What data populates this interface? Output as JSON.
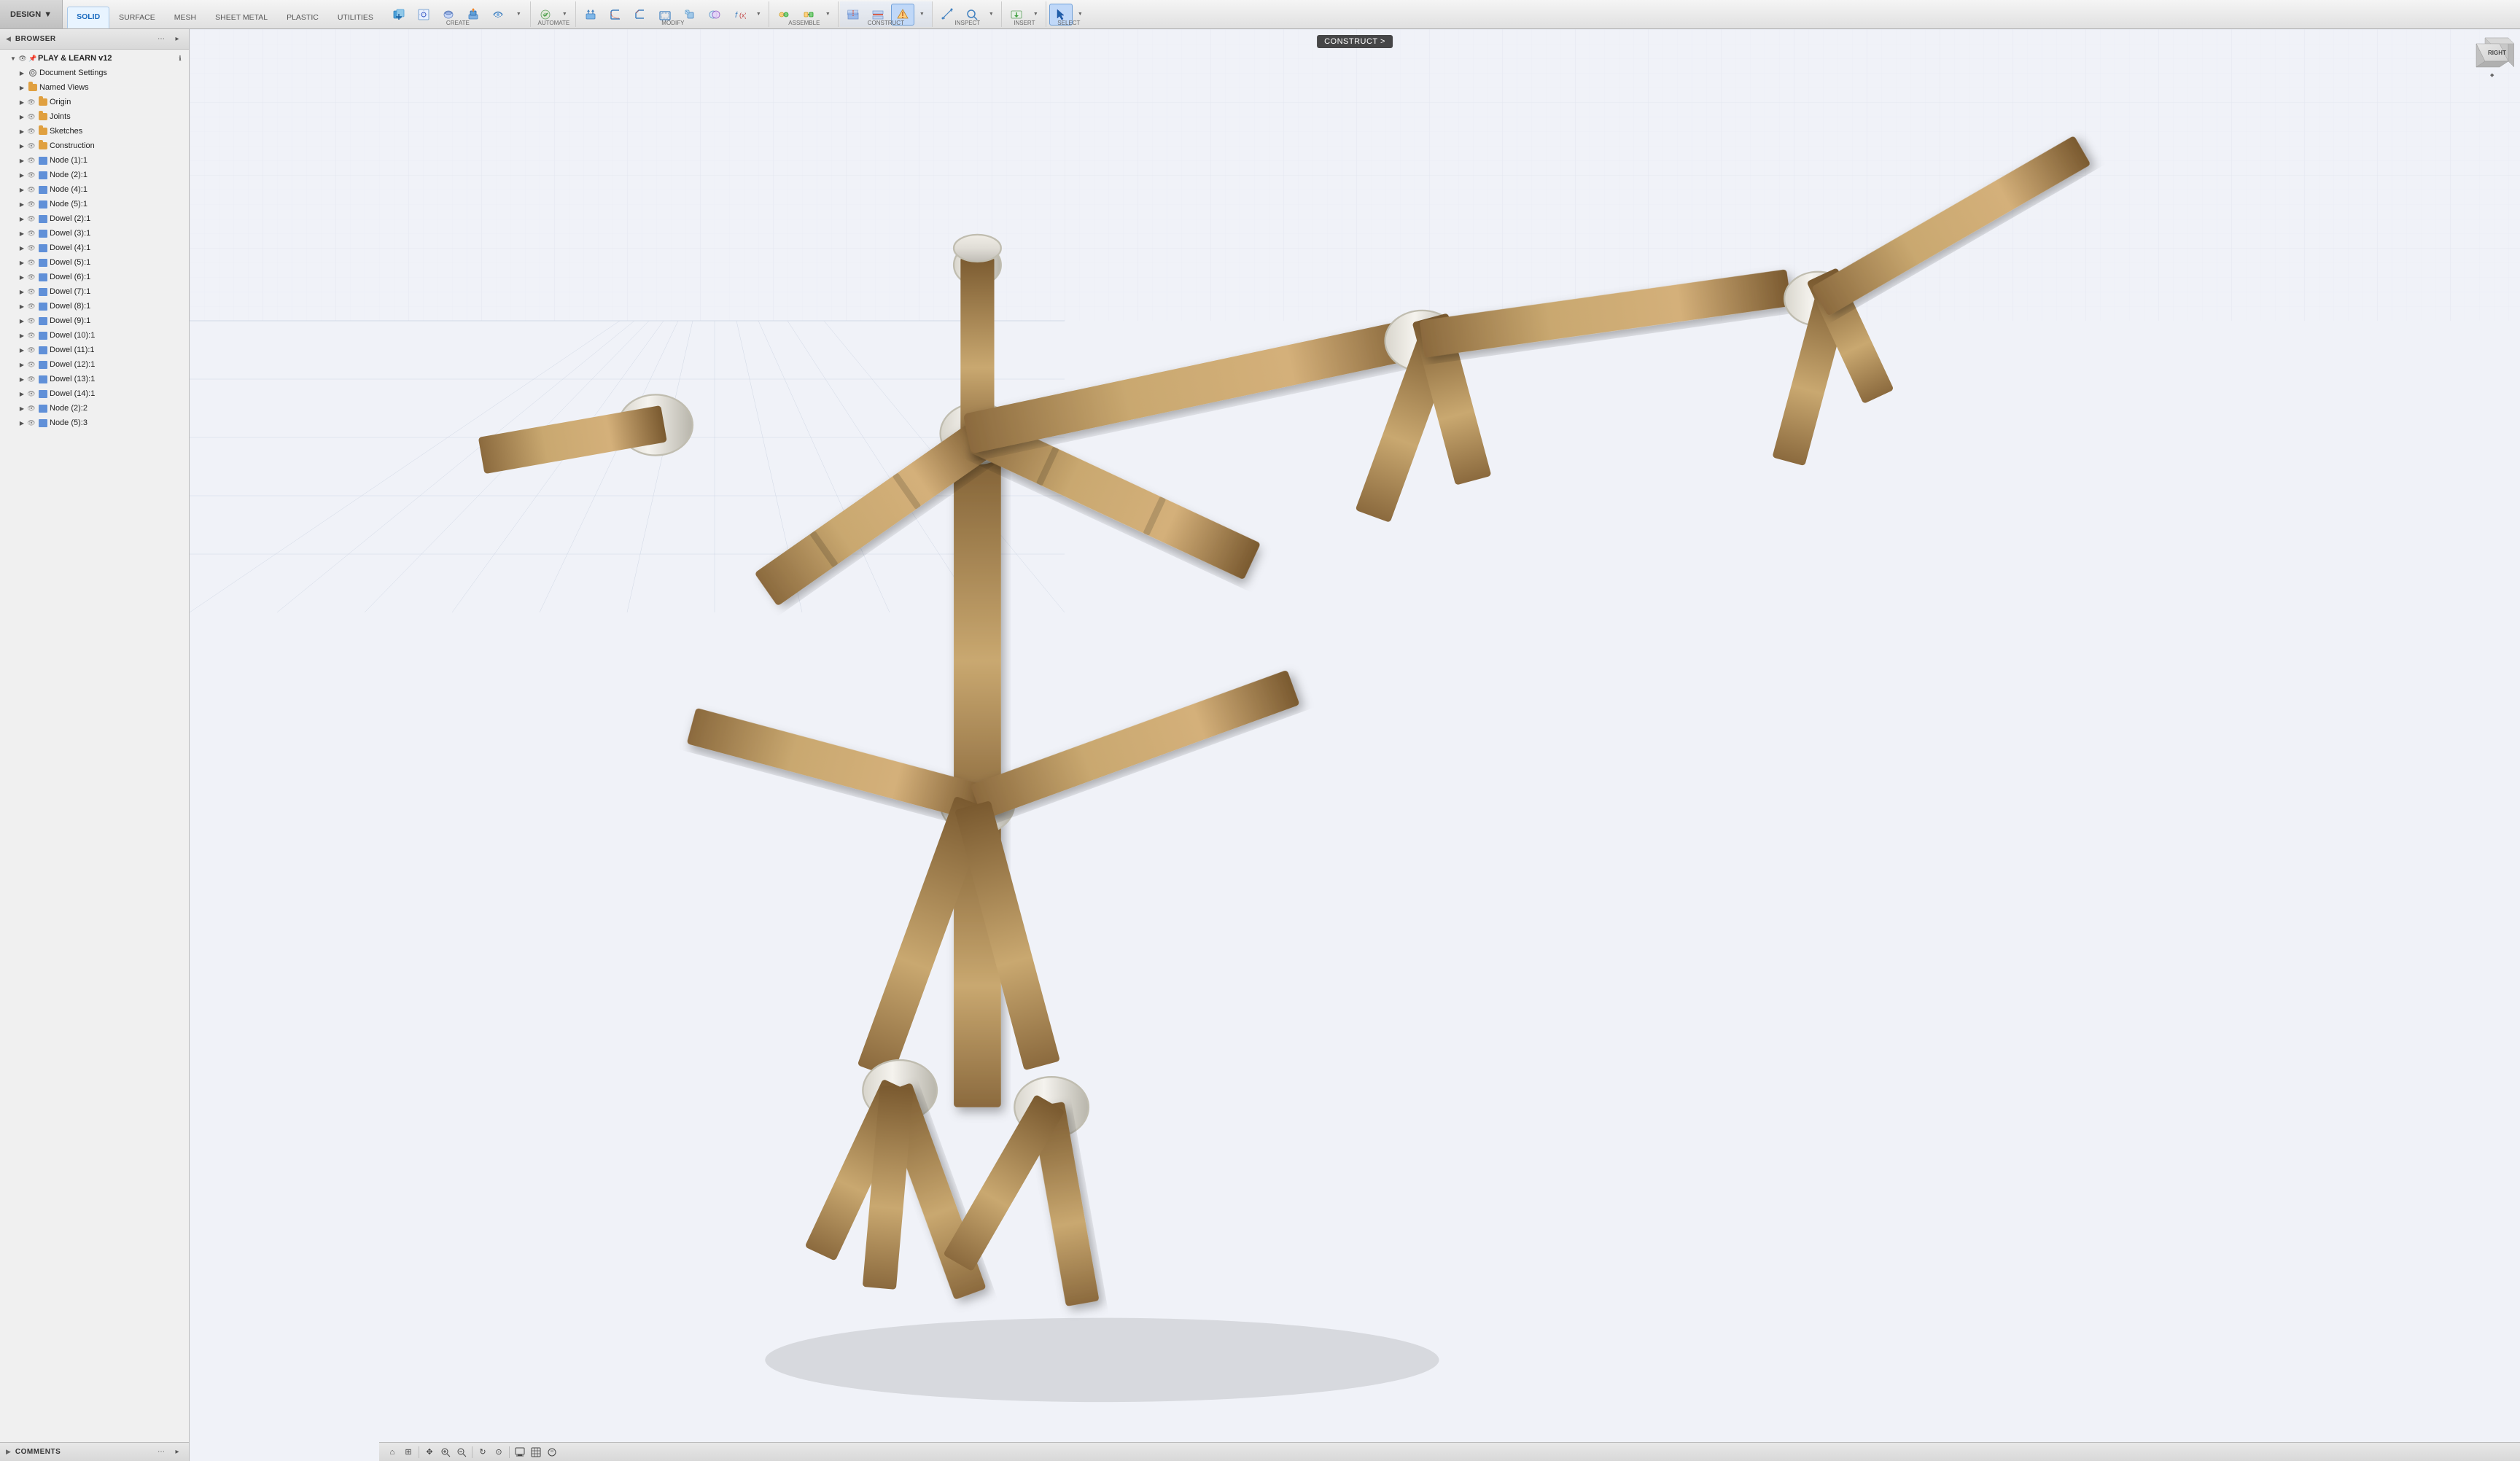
{
  "toolbar": {
    "design_label": "DESIGN",
    "design_arrow": "▼",
    "tabs": [
      {
        "id": "solid",
        "label": "SOLID",
        "active": true
      },
      {
        "id": "surface",
        "label": "SURFACE",
        "active": false
      },
      {
        "id": "mesh",
        "label": "MESH",
        "active": false
      },
      {
        "id": "sheet_metal",
        "label": "SHEET METAL",
        "active": false
      },
      {
        "id": "plastic",
        "label": "PLASTIC",
        "active": false
      },
      {
        "id": "utilities",
        "label": "UTILITIES",
        "active": false
      }
    ],
    "groups": {
      "create": {
        "label": "CREATE",
        "tools": [
          "new-component",
          "create-sketch",
          "create-form",
          "extrude",
          "revolve"
        ]
      },
      "automate": {
        "label": "AUTOMATE",
        "tools": [
          "automate"
        ]
      },
      "modify": {
        "label": "MODIFY",
        "tools": [
          "press-pull",
          "fillet",
          "chamfer",
          "shell",
          "scale",
          "combine",
          "formula"
        ]
      },
      "assemble": {
        "label": "ASSEMBLE",
        "tools": [
          "joint",
          "as-built-joint"
        ]
      },
      "construct": {
        "label": "CONSTRUCT",
        "tools": [
          "offset-plane",
          "midplane",
          "construct"
        ]
      },
      "inspect": {
        "label": "INSPECT",
        "tools": [
          "measure",
          "inspect"
        ]
      },
      "insert": {
        "label": "INSERT",
        "tools": [
          "insert"
        ]
      },
      "select": {
        "label": "SELECT",
        "tools": [
          "select"
        ]
      }
    }
  },
  "browser": {
    "header_label": "BROWSER",
    "collapse_icon": "◀",
    "document_title": "PLAY & LEARN v12",
    "items": [
      {
        "id": "document-settings",
        "label": "Document Settings",
        "indent": 1,
        "expandable": true,
        "has_eye": false,
        "icon": "gear"
      },
      {
        "id": "named-views",
        "label": "Named Views",
        "indent": 1,
        "expandable": true,
        "has_eye": false,
        "icon": "folder"
      },
      {
        "id": "origin",
        "label": "Origin",
        "indent": 1,
        "expandable": true,
        "has_eye": true,
        "icon": "folder"
      },
      {
        "id": "joints",
        "label": "Joints",
        "indent": 1,
        "expandable": true,
        "has_eye": true,
        "icon": "folder"
      },
      {
        "id": "sketches",
        "label": "Sketches",
        "indent": 1,
        "expandable": true,
        "has_eye": true,
        "icon": "folder"
      },
      {
        "id": "construction",
        "label": "Construction",
        "indent": 1,
        "expandable": true,
        "has_eye": true,
        "icon": "folder"
      },
      {
        "id": "node-1-1",
        "label": "Node (1):1",
        "indent": 1,
        "expandable": true,
        "has_eye": true,
        "icon": "box"
      },
      {
        "id": "node-2-1",
        "label": "Node (2):1",
        "indent": 1,
        "expandable": true,
        "has_eye": true,
        "icon": "box"
      },
      {
        "id": "node-4-1",
        "label": "Node (4):1",
        "indent": 1,
        "expandable": true,
        "has_eye": true,
        "icon": "box"
      },
      {
        "id": "node-5-1",
        "label": "Node (5):1",
        "indent": 1,
        "expandable": true,
        "has_eye": true,
        "icon": "box"
      },
      {
        "id": "dowel-2-1",
        "label": "Dowel (2):1",
        "indent": 1,
        "expandable": true,
        "has_eye": true,
        "icon": "box"
      },
      {
        "id": "dowel-3-1",
        "label": "Dowel (3):1",
        "indent": 1,
        "expandable": true,
        "has_eye": true,
        "icon": "box"
      },
      {
        "id": "dowel-4-1",
        "label": "Dowel (4):1",
        "indent": 1,
        "expandable": true,
        "has_eye": true,
        "icon": "box"
      },
      {
        "id": "dowel-5-1",
        "label": "Dowel (5):1",
        "indent": 1,
        "expandable": true,
        "has_eye": true,
        "icon": "box"
      },
      {
        "id": "dowel-6-1",
        "label": "Dowel (6):1",
        "indent": 1,
        "expandable": true,
        "has_eye": true,
        "icon": "box"
      },
      {
        "id": "dowel-7-1",
        "label": "Dowel (7):1",
        "indent": 1,
        "expandable": true,
        "has_eye": true,
        "icon": "box"
      },
      {
        "id": "dowel-8-1",
        "label": "Dowel (8):1",
        "indent": 1,
        "expandable": true,
        "has_eye": true,
        "icon": "box"
      },
      {
        "id": "dowel-9-1",
        "label": "Dowel (9):1",
        "indent": 1,
        "expandable": true,
        "has_eye": true,
        "icon": "box"
      },
      {
        "id": "dowel-10-1",
        "label": "Dowel (10):1",
        "indent": 1,
        "expandable": true,
        "has_eye": true,
        "icon": "box"
      },
      {
        "id": "dowel-11-1",
        "label": "Dowel (11):1",
        "indent": 1,
        "expandable": true,
        "has_eye": true,
        "icon": "box"
      },
      {
        "id": "dowel-12-1",
        "label": "Dowel (12):1",
        "indent": 1,
        "expandable": true,
        "has_eye": true,
        "icon": "box"
      },
      {
        "id": "dowel-13-1",
        "label": "Dowel (13):1",
        "indent": 1,
        "expandable": true,
        "has_eye": true,
        "icon": "box"
      },
      {
        "id": "dowel-14-1",
        "label": "Dowel (14):1",
        "indent": 1,
        "expandable": true,
        "has_eye": true,
        "icon": "box"
      },
      {
        "id": "node-2-2",
        "label": "Node (2):2",
        "indent": 1,
        "expandable": true,
        "has_eye": true,
        "icon": "box"
      },
      {
        "id": "node-5-3",
        "label": "Node (5):3",
        "indent": 1,
        "expandable": true,
        "has_eye": true,
        "icon": "box"
      }
    ]
  },
  "construct_tooltip": "CONSTRUCT >",
  "comments_label": "COMMENTS",
  "viewcube": {
    "face": "RIGHT"
  },
  "bottom_tools": [
    "home",
    "fit",
    "pan",
    "zoom-window",
    "zoom-in",
    "orbit",
    "look-at",
    "display-settings",
    "grid-settings",
    "render-settings"
  ]
}
